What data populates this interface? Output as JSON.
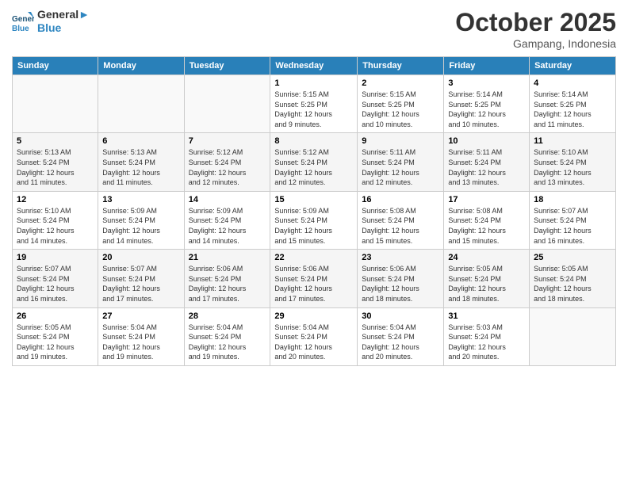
{
  "header": {
    "logo_line1": "General",
    "logo_line2": "Blue",
    "month": "October 2025",
    "location": "Gampang, Indonesia"
  },
  "days_of_week": [
    "Sunday",
    "Monday",
    "Tuesday",
    "Wednesday",
    "Thursday",
    "Friday",
    "Saturday"
  ],
  "weeks": [
    [
      {
        "num": "",
        "detail": ""
      },
      {
        "num": "",
        "detail": ""
      },
      {
        "num": "",
        "detail": ""
      },
      {
        "num": "1",
        "detail": "Sunrise: 5:15 AM\nSunset: 5:25 PM\nDaylight: 12 hours\nand 9 minutes."
      },
      {
        "num": "2",
        "detail": "Sunrise: 5:15 AM\nSunset: 5:25 PM\nDaylight: 12 hours\nand 10 minutes."
      },
      {
        "num": "3",
        "detail": "Sunrise: 5:14 AM\nSunset: 5:25 PM\nDaylight: 12 hours\nand 10 minutes."
      },
      {
        "num": "4",
        "detail": "Sunrise: 5:14 AM\nSunset: 5:25 PM\nDaylight: 12 hours\nand 11 minutes."
      }
    ],
    [
      {
        "num": "5",
        "detail": "Sunrise: 5:13 AM\nSunset: 5:24 PM\nDaylight: 12 hours\nand 11 minutes."
      },
      {
        "num": "6",
        "detail": "Sunrise: 5:13 AM\nSunset: 5:24 PM\nDaylight: 12 hours\nand 11 minutes."
      },
      {
        "num": "7",
        "detail": "Sunrise: 5:12 AM\nSunset: 5:24 PM\nDaylight: 12 hours\nand 12 minutes."
      },
      {
        "num": "8",
        "detail": "Sunrise: 5:12 AM\nSunset: 5:24 PM\nDaylight: 12 hours\nand 12 minutes."
      },
      {
        "num": "9",
        "detail": "Sunrise: 5:11 AM\nSunset: 5:24 PM\nDaylight: 12 hours\nand 12 minutes."
      },
      {
        "num": "10",
        "detail": "Sunrise: 5:11 AM\nSunset: 5:24 PM\nDaylight: 12 hours\nand 13 minutes."
      },
      {
        "num": "11",
        "detail": "Sunrise: 5:10 AM\nSunset: 5:24 PM\nDaylight: 12 hours\nand 13 minutes."
      }
    ],
    [
      {
        "num": "12",
        "detail": "Sunrise: 5:10 AM\nSunset: 5:24 PM\nDaylight: 12 hours\nand 14 minutes."
      },
      {
        "num": "13",
        "detail": "Sunrise: 5:09 AM\nSunset: 5:24 PM\nDaylight: 12 hours\nand 14 minutes."
      },
      {
        "num": "14",
        "detail": "Sunrise: 5:09 AM\nSunset: 5:24 PM\nDaylight: 12 hours\nand 14 minutes."
      },
      {
        "num": "15",
        "detail": "Sunrise: 5:09 AM\nSunset: 5:24 PM\nDaylight: 12 hours\nand 15 minutes."
      },
      {
        "num": "16",
        "detail": "Sunrise: 5:08 AM\nSunset: 5:24 PM\nDaylight: 12 hours\nand 15 minutes."
      },
      {
        "num": "17",
        "detail": "Sunrise: 5:08 AM\nSunset: 5:24 PM\nDaylight: 12 hours\nand 15 minutes."
      },
      {
        "num": "18",
        "detail": "Sunrise: 5:07 AM\nSunset: 5:24 PM\nDaylight: 12 hours\nand 16 minutes."
      }
    ],
    [
      {
        "num": "19",
        "detail": "Sunrise: 5:07 AM\nSunset: 5:24 PM\nDaylight: 12 hours\nand 16 minutes."
      },
      {
        "num": "20",
        "detail": "Sunrise: 5:07 AM\nSunset: 5:24 PM\nDaylight: 12 hours\nand 17 minutes."
      },
      {
        "num": "21",
        "detail": "Sunrise: 5:06 AM\nSunset: 5:24 PM\nDaylight: 12 hours\nand 17 minutes."
      },
      {
        "num": "22",
        "detail": "Sunrise: 5:06 AM\nSunset: 5:24 PM\nDaylight: 12 hours\nand 17 minutes."
      },
      {
        "num": "23",
        "detail": "Sunrise: 5:06 AM\nSunset: 5:24 PM\nDaylight: 12 hours\nand 18 minutes."
      },
      {
        "num": "24",
        "detail": "Sunrise: 5:05 AM\nSunset: 5:24 PM\nDaylight: 12 hours\nand 18 minutes."
      },
      {
        "num": "25",
        "detail": "Sunrise: 5:05 AM\nSunset: 5:24 PM\nDaylight: 12 hours\nand 18 minutes."
      }
    ],
    [
      {
        "num": "26",
        "detail": "Sunrise: 5:05 AM\nSunset: 5:24 PM\nDaylight: 12 hours\nand 19 minutes."
      },
      {
        "num": "27",
        "detail": "Sunrise: 5:04 AM\nSunset: 5:24 PM\nDaylight: 12 hours\nand 19 minutes."
      },
      {
        "num": "28",
        "detail": "Sunrise: 5:04 AM\nSunset: 5:24 PM\nDaylight: 12 hours\nand 19 minutes."
      },
      {
        "num": "29",
        "detail": "Sunrise: 5:04 AM\nSunset: 5:24 PM\nDaylight: 12 hours\nand 20 minutes."
      },
      {
        "num": "30",
        "detail": "Sunrise: 5:04 AM\nSunset: 5:24 PM\nDaylight: 12 hours\nand 20 minutes."
      },
      {
        "num": "31",
        "detail": "Sunrise: 5:03 AM\nSunset: 5:24 PM\nDaylight: 12 hours\nand 20 minutes."
      },
      {
        "num": "",
        "detail": ""
      }
    ]
  ]
}
